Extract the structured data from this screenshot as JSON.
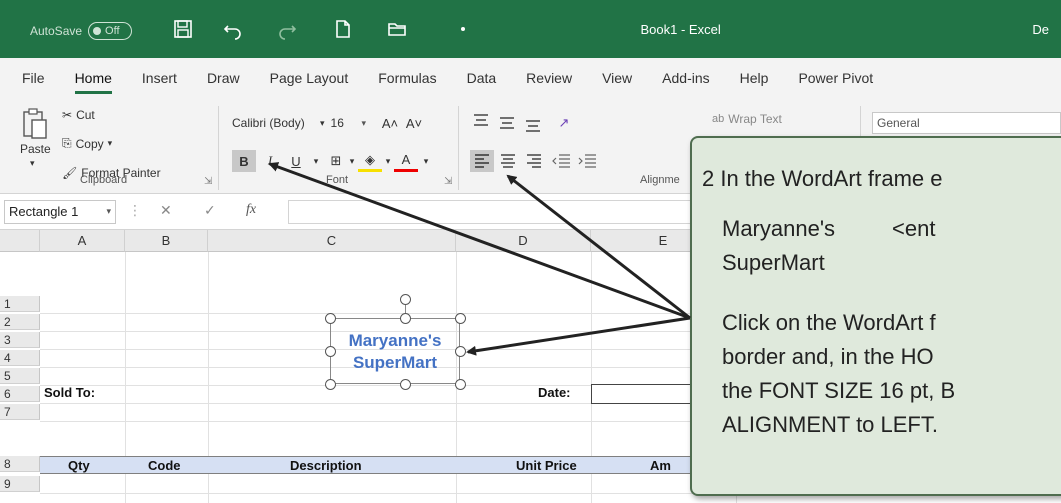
{
  "titlebar": {
    "autosave_label": "AutoSave",
    "autosave_state": "Off",
    "title": "Book1  -  Excel",
    "user": "De"
  },
  "tabs": [
    "File",
    "Home",
    "Insert",
    "Draw",
    "Page Layout",
    "Formulas",
    "Data",
    "Review",
    "View",
    "Add-ins",
    "Help",
    "Power Pivot"
  ],
  "active_tab": "Home",
  "ribbon": {
    "clipboard": {
      "paste": "Paste",
      "cut": "Cut",
      "copy": "Copy",
      "format_painter": "Format Painter",
      "label": "Clipboard"
    },
    "font": {
      "family": "Calibri (Body)",
      "size": "16",
      "grow": "A˄",
      "shrink": "A˅",
      "bold": "B",
      "italic": "I",
      "underline": "U",
      "font_color": "A",
      "label": "Font"
    },
    "alignment": {
      "wrap_text": "Wrap Text",
      "label": "Alignme"
    },
    "number": {
      "format": "General"
    }
  },
  "formula_bar": {
    "name_box": "Rectangle 1",
    "fx": "fx"
  },
  "columns": [
    "A",
    "B",
    "C",
    "D",
    "E"
  ],
  "rows": [
    "1",
    "2",
    "3",
    "4",
    "5",
    "6",
    "7",
    "8",
    "9"
  ],
  "cells": {
    "sold_to": "Sold To:",
    "date": "Date:",
    "hdr_qty": "Qty",
    "hdr_code": "Code",
    "hdr_description": "Description",
    "hdr_unit_price": "Unit Price",
    "hdr_amount": "Am"
  },
  "wordart": {
    "line1": "Maryanne's",
    "line2": "SuperMart"
  },
  "callout": {
    "step": "2  In the WordArt frame e",
    "line2a": "Maryanne's",
    "line2b": "<ent",
    "line3": "SuperMart",
    "line4": "Click on the WordArt f",
    "line5": "border and, in the HO",
    "line6": "the FONT SIZE 16 pt, B",
    "line7": "ALIGNMENT to LEFT."
  },
  "colors": {
    "excel_green": "#217346",
    "wordart_blue": "#4472c4",
    "header_fill": "#d6e0f3",
    "callout_fill": "#dfe9dc"
  }
}
